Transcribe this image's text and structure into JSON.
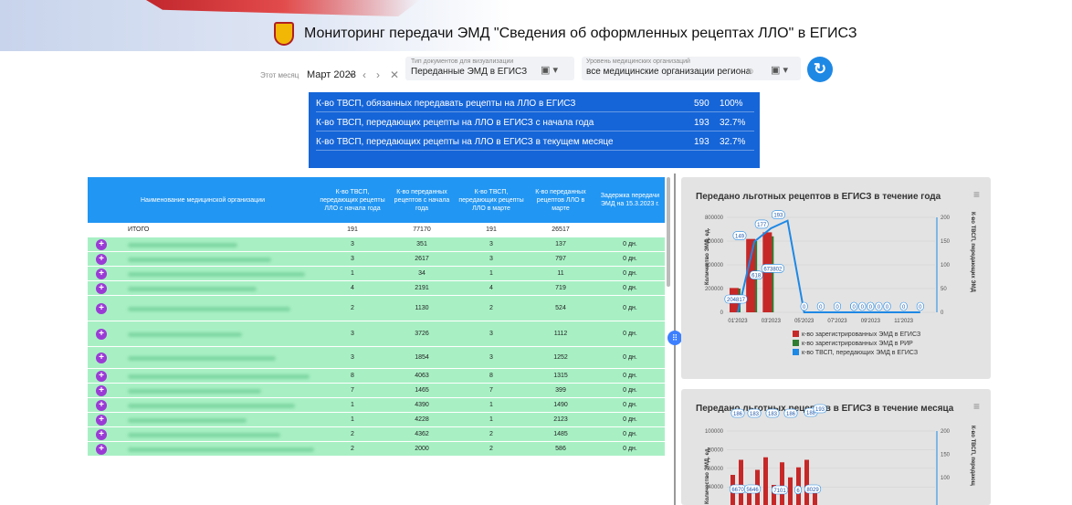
{
  "header": {
    "title": "Мониторинг передачи ЭМД \"Сведения об оформленных рецептах ЛЛО\" в ЕГИСЗ"
  },
  "filters": {
    "period_caption": "Этот месяц",
    "period_value": "Март 2023",
    "doc_type_caption": "Тип документов для визуализации",
    "doc_type_value": "Переданные ЭМД в ЕГИСЗ",
    "org_level_caption": "Уровень медицинских организаций",
    "org_level_value": "все медицинские организации региона"
  },
  "stats": [
    {
      "label": "К-во ТВСП, обязанных передавать рецепты на ЛЛО в ЕГИСЗ",
      "value": "590",
      "percent": "100%"
    },
    {
      "label": "К-во ТВСП, передающих рецепты на ЛЛО в ЕГИСЗ с начала года",
      "value": "193",
      "percent": "32.7%"
    },
    {
      "label": "К-во ТВСП, передающих рецепты на ЛЛО в ЕГИСЗ в текущем месяце",
      "value": "193",
      "percent": "32.7%"
    }
  ],
  "table": {
    "headers": [
      "Наименование медицинской организации",
      "К-во ТВСП, передающих рецепты ЛЛО с начала года",
      "К-во переданных рецептов с начала года",
      "К-во ТВСП, передающих рецепты ЛЛО в марте",
      "К-во переданных рецептов ЛЛО в марте",
      "Задержка передачи ЭМД на 15.3.2023 г."
    ],
    "total": {
      "name": "ИТОГО",
      "c1": "191",
      "c2": "77170",
      "c3": "191",
      "c4": "26517"
    },
    "rows": [
      {
        "c1": "3",
        "c2": "351",
        "c3": "3",
        "c4": "137",
        "c5": "0 дн."
      },
      {
        "c1": "3",
        "c2": "2617",
        "c3": "3",
        "c4": "797",
        "c5": "0 дн."
      },
      {
        "c1": "1",
        "c2": "34",
        "c3": "1",
        "c4": "11",
        "c5": "0 дн."
      },
      {
        "c1": "4",
        "c2": "2191",
        "c3": "4",
        "c4": "719",
        "c5": "0 дн."
      },
      {
        "c1": "2",
        "c2": "1130",
        "c3": "2",
        "c4": "524",
        "c5": "0 дн."
      },
      {
        "c1": "3",
        "c2": "3726",
        "c3": "3",
        "c4": "1112",
        "c5": "0 дн."
      },
      {
        "c1": "3",
        "c2": "1854",
        "c3": "3",
        "c4": "1252",
        "c5": "0 дн."
      },
      {
        "c1": "8",
        "c2": "4063",
        "c3": "8",
        "c4": "1315",
        "c5": "0 дн."
      },
      {
        "c1": "7",
        "c2": "1465",
        "c3": "7",
        "c4": "399",
        "c5": "0 дн."
      },
      {
        "c1": "1",
        "c2": "4390",
        "c3": "1",
        "c4": "1490",
        "c5": "0 дн."
      },
      {
        "c1": "1",
        "c2": "4228",
        "c3": "1",
        "c4": "2123",
        "c5": "0 дн."
      },
      {
        "c1": "2",
        "c2": "4362",
        "c3": "2",
        "c4": "1485",
        "c5": "0 дн."
      },
      {
        "c1": "2",
        "c2": "2000",
        "c3": "2",
        "c4": "586",
        "c5": "0 дн."
      }
    ]
  },
  "chart_data": [
    {
      "type": "bar",
      "title": "Передано льготных рецептов в ЕГИСЗ в течение года",
      "ylabel": "Количество ЭМД, ед.",
      "ylabel_right": "К-во ТВСП, передающих ЭМД",
      "ylim": [
        0,
        800000
      ],
      "ylim_right": [
        0,
        200
      ],
      "y_ticks": [
        "0",
        "200000",
        "400000",
        "600000",
        "800000"
      ],
      "y_ticks_right": [
        "0",
        "50",
        "100",
        "150",
        "200"
      ],
      "x_ticks": [
        "01'2023",
        "03'2023",
        "05'2023",
        "07'2023",
        "09'2023",
        "11'2023"
      ],
      "categories": [
        "01'2023",
        "02'2023",
        "03'2023",
        "04'2023",
        "05'2023",
        "06'2023",
        "07'2023",
        "08'2023",
        "09'2023",
        "10'2023",
        "11'2023",
        "12'2023"
      ],
      "series": [
        {
          "name": "к-во зарегистрированных ЭМД в ЕГИСЗ",
          "color": "#c62828",
          "values": [
            204817,
            618000,
            673802,
            0,
            0,
            0,
            0,
            0,
            0,
            0,
            0,
            0
          ]
        },
        {
          "name": "к-во зарегистрированных ЭМД в РИР",
          "color": "#2e7d32",
          "values": [
            200000,
            600000,
            640000,
            0,
            0,
            0,
            0,
            0,
            0,
            0,
            0,
            0
          ]
        },
        {
          "name": "к-во ТВСП, передающих ЭМД в ЕГИСЗ",
          "color": "#1e88e5",
          "values": [
            0,
            149,
            177,
            193,
            0,
            0,
            0,
            0,
            0,
            0,
            0,
            0
          ]
        }
      ],
      "data_labels": [
        "204817",
        "149",
        "618",
        "673802",
        "177",
        "193",
        "0",
        "0",
        "0",
        "0",
        "0",
        "0",
        "0",
        "0",
        "0",
        "0",
        "0",
        "0",
        "0"
      ],
      "legend": "bottom",
      "grid": true
    },
    {
      "type": "bar",
      "title": "Передано льготных рецептов в ЕГИСЗ в течение месяца",
      "ylabel": "Количество ЭМД, ед.",
      "ylabel_right": "К-во ТВСП, передающ",
      "ylim": [
        0,
        100000
      ],
      "ylim_right": [
        0,
        200
      ],
      "y_ticks": [
        "40000",
        "60000",
        "80000",
        "100000"
      ],
      "y_ticks_right": [
        "100",
        "150",
        "200"
      ],
      "data_labels": [
        "186",
        "183",
        "183",
        "186",
        "188",
        "193",
        "6670",
        "5646",
        "7101",
        "6",
        "8029"
      ]
    }
  ]
}
